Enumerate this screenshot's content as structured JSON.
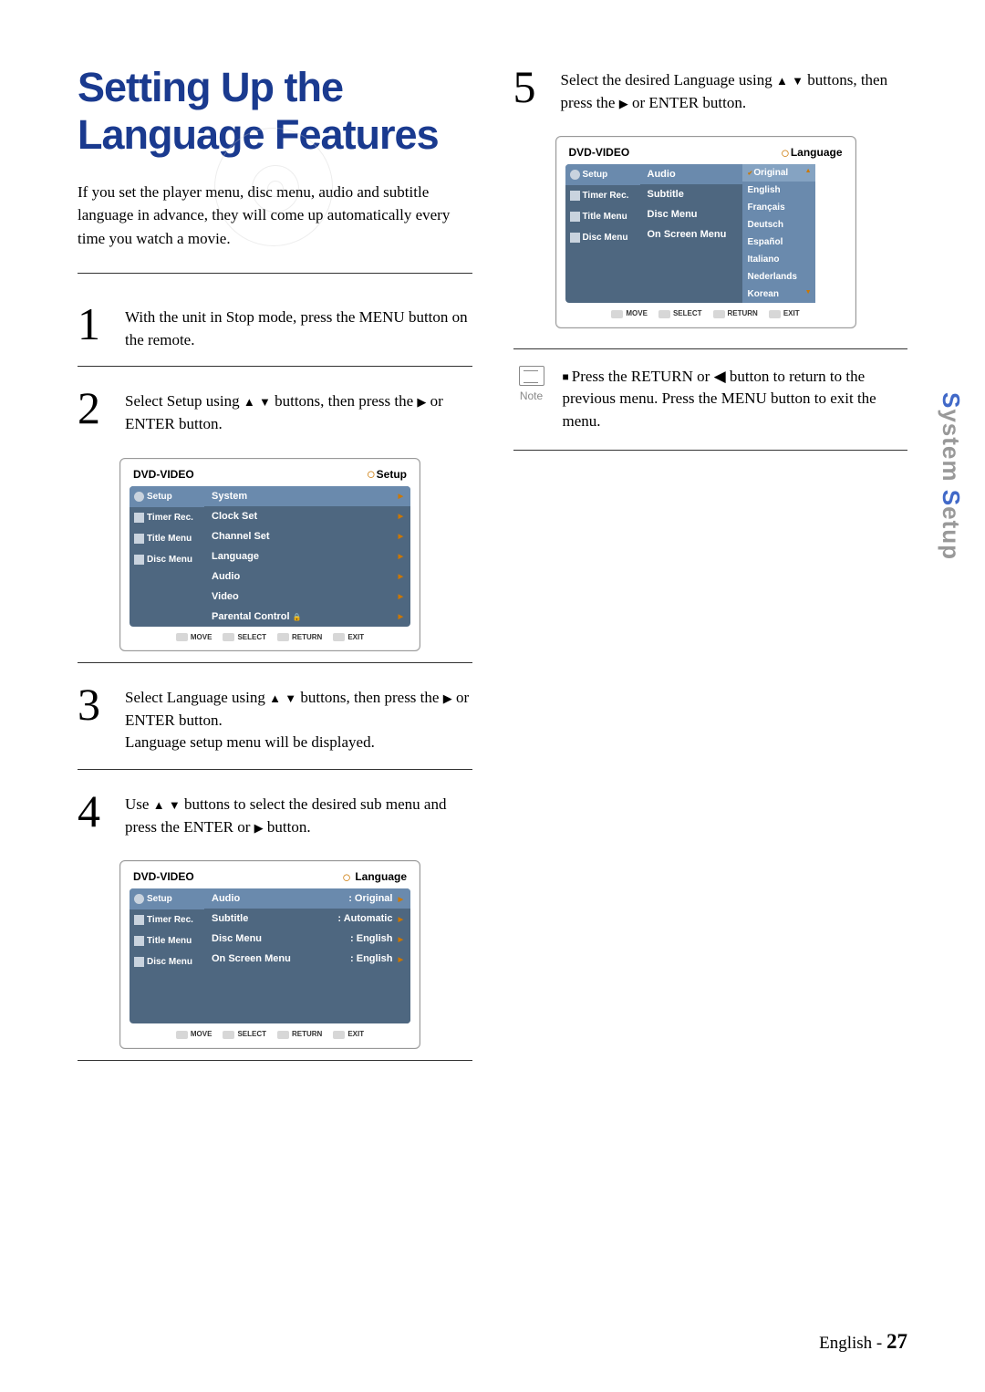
{
  "title_line1": "Setting Up the",
  "title_line2": "Language Features",
  "intro": "If you set the player menu, disc menu, audio and subtitle language in advance, they will come up automatically every time you watch a movie.",
  "steps": {
    "s1": {
      "num": "1",
      "text": "With the unit in Stop mode, press the MENU button on the remote."
    },
    "s2": {
      "num": "2",
      "text_a": "Select Setup using ",
      "text_b": " buttons, then press the ",
      "text_c": " or ENTER button."
    },
    "s3": {
      "num": "3",
      "text_a": "Select Language using ",
      "text_b": " buttons, then press the ",
      "text_c": " or ENTER button.",
      "text_d": "Language setup menu will be displayed."
    },
    "s4": {
      "num": "4",
      "text_a": "Use ",
      "text_b": " buttons to select the desired sub menu and press the ENTER or ",
      "text_c": " button."
    },
    "s5": {
      "num": "5",
      "text_a": "Select the desired Language using ",
      "text_b": " buttons, then press the ",
      "text_c": " or ENTER button."
    }
  },
  "note": {
    "label": "Note",
    "text": "Press the RETURN or ◀ button to return to the previous menu. Press the MENU button to exit the menu."
  },
  "osd_common": {
    "top": "DVD-VIDEO",
    "side": {
      "setup": "Setup",
      "timer": "Timer Rec.",
      "title": "Title Menu",
      "disc": "Disc Menu"
    },
    "footer": {
      "move": "MOVE",
      "select": "SELECT",
      "return": "RETURN",
      "exit": "EXIT"
    }
  },
  "osd1": {
    "crumb": "Setup",
    "items": {
      "system": "System",
      "clock": "Clock Set",
      "channel": "Channel Set",
      "language": "Language",
      "audio": "Audio",
      "video": "Video",
      "parental": "Parental Control"
    }
  },
  "osd2": {
    "crumb": "Language",
    "items": {
      "audio": "Audio",
      "subtitle": "Subtitle",
      "discmenu": "Disc Menu",
      "osm": "On Screen Menu"
    },
    "vals": {
      "audio": ": Original",
      "subtitle": ": Automatic",
      "discmenu": ": English",
      "osm": ": English"
    }
  },
  "osd3": {
    "crumb": "Language",
    "items": {
      "audio": "Audio",
      "subtitle": "Subtitle",
      "discmenu": "Disc Menu",
      "osm": "On Screen Menu"
    },
    "langs": {
      "original": "Original",
      "english": "English",
      "francais": "Français",
      "deutsch": "Deutsch",
      "espanol": "Español",
      "italiano": "Italiano",
      "nederlands": "Nederlands",
      "korean": "Korean"
    }
  },
  "sidetab": {
    "a": "S",
    "b": "ystem ",
    "c": "S",
    "d": "etup"
  },
  "footer": {
    "lang": "English - ",
    "page": "27"
  }
}
